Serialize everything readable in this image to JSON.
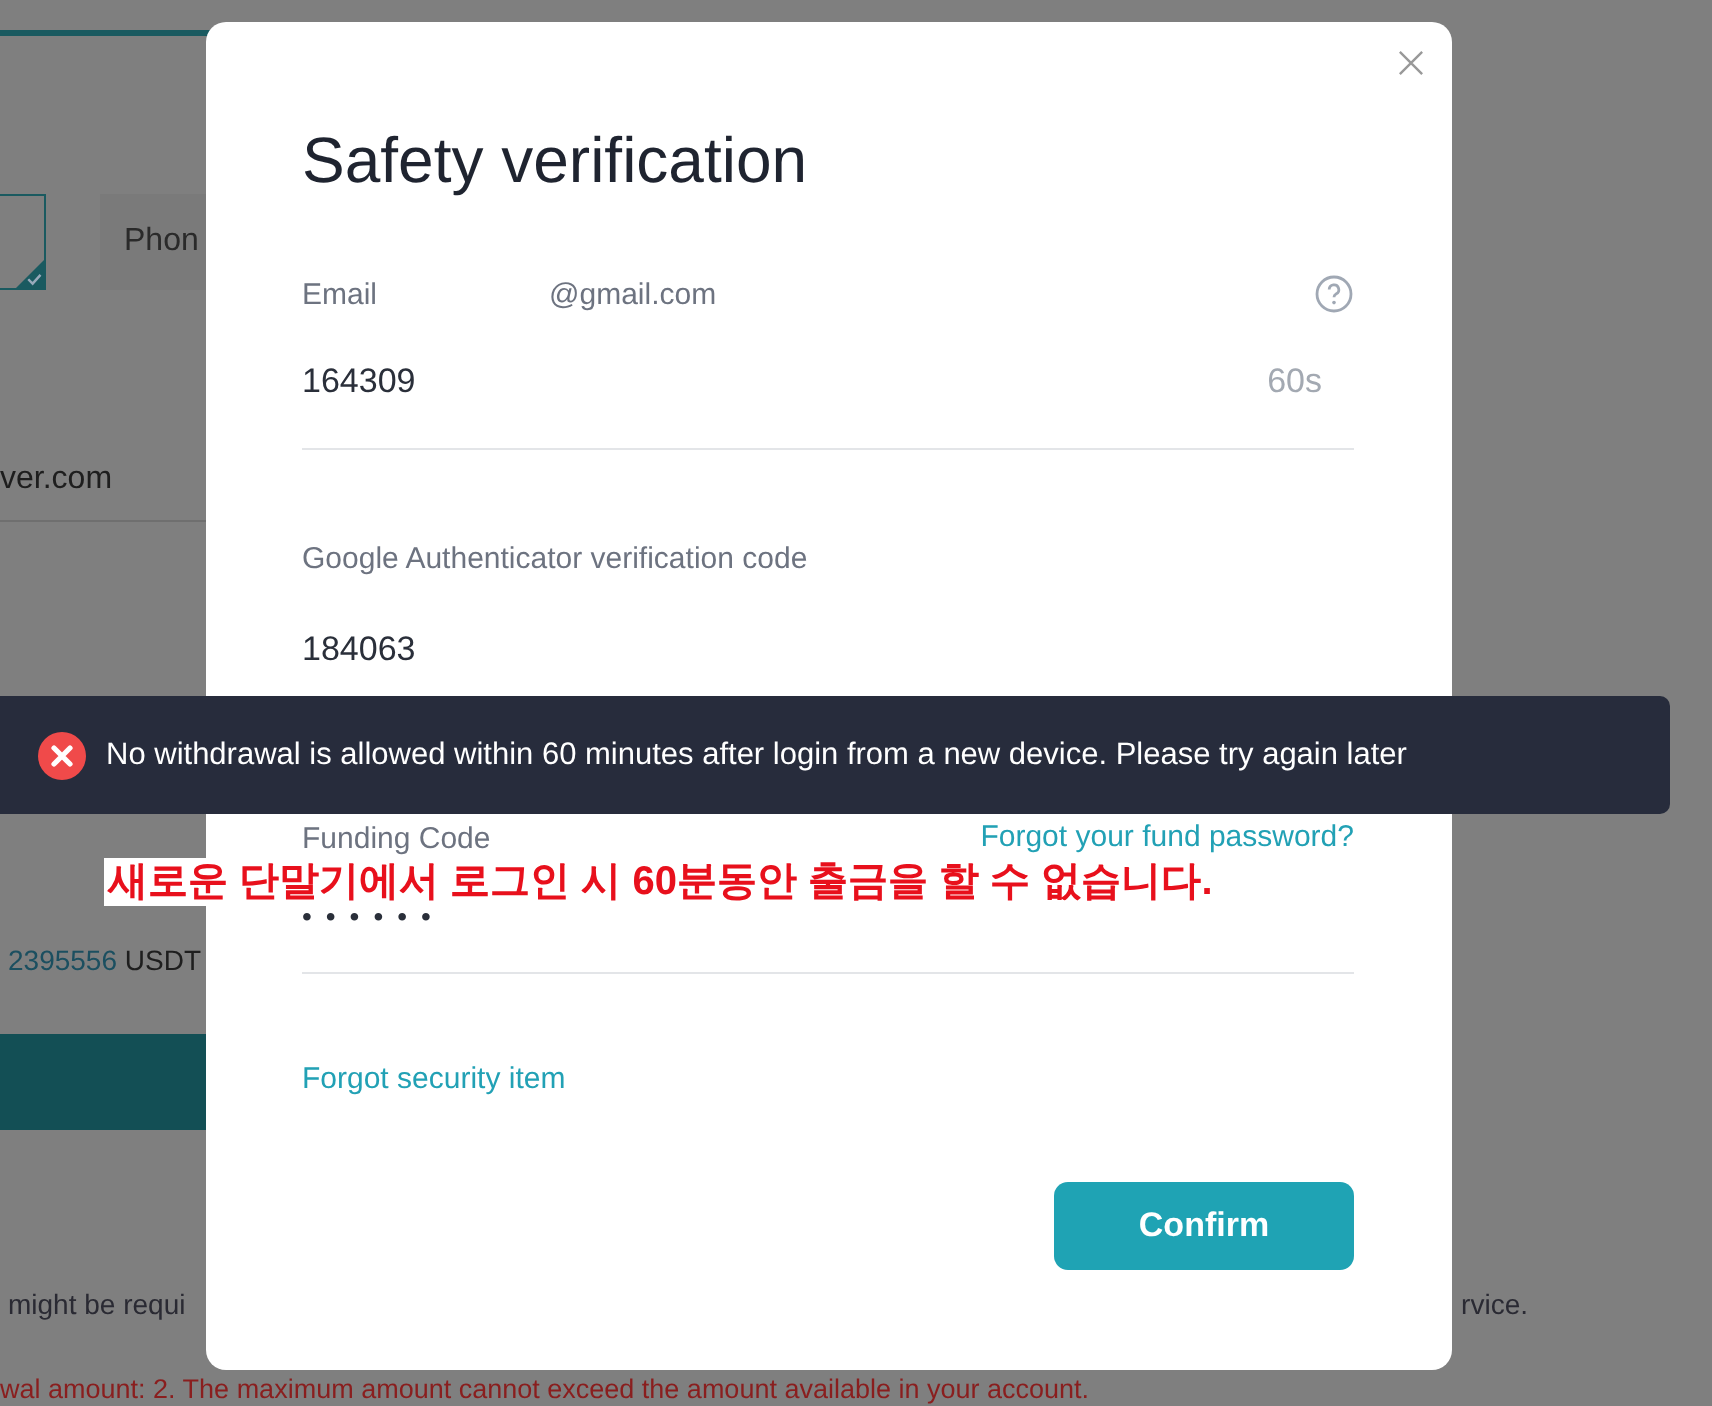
{
  "background_page": {
    "option_cards": [
      {
        "selected": true
      },
      {
        "label": "Phon",
        "selected": false
      }
    ],
    "address_suffix": "ver.com",
    "balance_amount": "2395556",
    "balance_unit": "USDT",
    "note_fragment_left": "might be requi",
    "note_fragment_right": "rvice.",
    "warning_line": "wal amount: 2. The maximum amount cannot exceed the amount available in your account."
  },
  "dialog": {
    "title": "Safety verification",
    "email": {
      "label": "Email",
      "address": "@gmail.com",
      "code": "164309",
      "countdown": "60s"
    },
    "google": {
      "label": "Google Authenticator verification code",
      "code": "184063"
    },
    "funding": {
      "label": "Funding Code",
      "link": "Forgot your fund password?",
      "value": "••••••"
    },
    "forgot_link": "Forgot security item",
    "confirm": "Confirm"
  },
  "toast": {
    "kind": "error",
    "message": "No withdrawal is allowed within 60 minutes after login from a new device. Please try again later"
  },
  "annotation": "새로운 단말기에서 로그인 시 60분동안 출금을 할 수 없습니다."
}
